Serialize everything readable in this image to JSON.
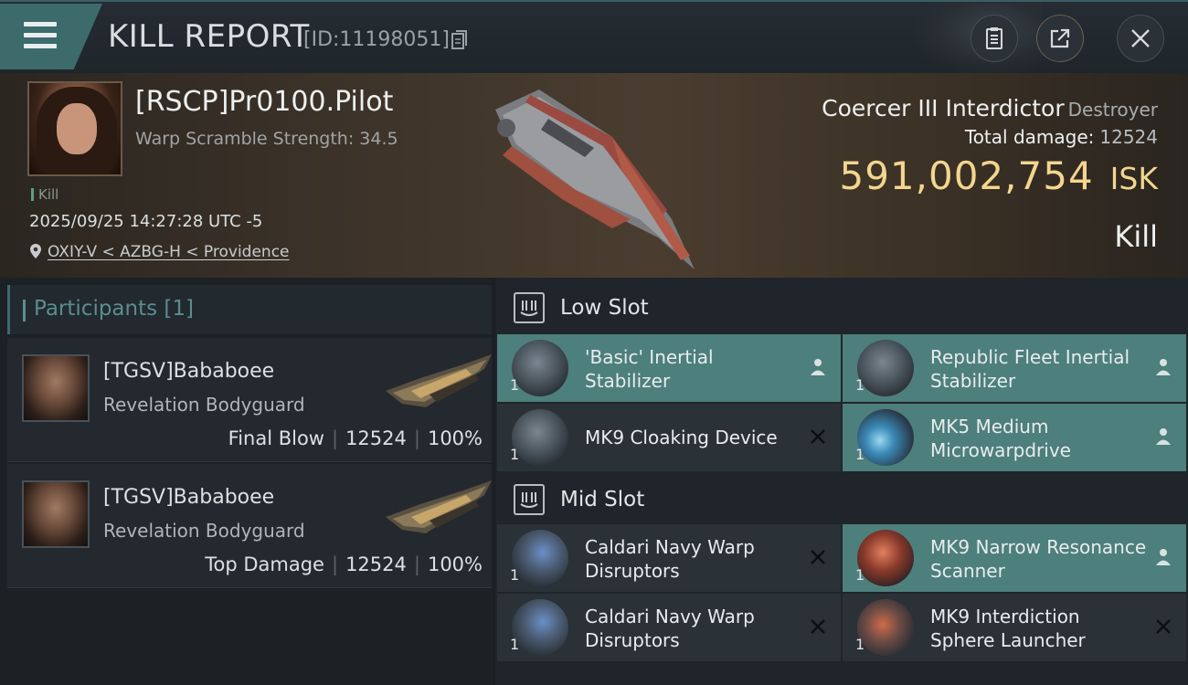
{
  "header": {
    "title": "KILL REPORT",
    "report_id": "[ID:11198051]"
  },
  "victim": {
    "name": "[RSCP]Pr0100.Pilot",
    "warp_scramble": "Warp Scramble Strength: 34.5",
    "tag": "Kill",
    "time": "2025/09/25 14:27:28 UTC -5",
    "location": "OXIY-V < AZBG-H < Providence",
    "ship_name": "Coercer III Interdictor",
    "ship_class": "Destroyer",
    "damage_label": "Total damage:",
    "damage_value": "12524",
    "isk_value": "591,002,754",
    "isk_unit": "ISK",
    "kill_type": "Kill"
  },
  "participants": {
    "label": "Participants",
    "count": "[1]",
    "items": [
      {
        "name": "[TGSV]Bababoee",
        "ship": "Revelation Bodyguard",
        "role": "Final Blow",
        "damage": "12524",
        "percent": "100%"
      },
      {
        "name": "[TGSV]Bababoee",
        "ship": "Revelation Bodyguard",
        "role": "Top Damage",
        "damage": "12524",
        "percent": "100%"
      }
    ]
  },
  "low_slot": {
    "label": "Low Slot",
    "modules": [
      {
        "name": "'Basic' Inertial Stabilizer",
        "qty": "1",
        "status": "owned"
      },
      {
        "name": "Republic Fleet Inertial Stabilizer",
        "qty": "1",
        "status": "owned"
      },
      {
        "name": "MK9 Cloaking Device",
        "qty": "1",
        "status": "destroyed"
      },
      {
        "name": "MK5 Medium Microwarpdrive",
        "qty": "1",
        "status": "owned"
      }
    ]
  },
  "mid_slot": {
    "label": "Mid Slot",
    "modules": [
      {
        "name": "Caldari Navy Warp Disruptors",
        "qty": "1",
        "status": "destroyed"
      },
      {
        "name": "MK9 Narrow Resonance Scanner",
        "qty": "1",
        "status": "owned"
      },
      {
        "name": "Caldari Navy Warp Disruptors",
        "qty": "1",
        "status": "destroyed"
      },
      {
        "name": "MK9 Interdiction Sphere Launcher",
        "qty": "1",
        "status": "destroyed"
      }
    ]
  },
  "icons": {
    "menu": "hamburger-icon",
    "copy": "copy-icon",
    "clipboard": "clipboard-icon",
    "share": "share-icon",
    "close": "close-icon",
    "location": "location-pin-icon",
    "slot": "slot-shield-icon",
    "owned": "person-icon",
    "destroyed": "x-icon"
  },
  "colors": {
    "accent_teal": "#4d7f7c",
    "isk_gold": "#f3d58e",
    "kill_green": "#5aa27a"
  }
}
